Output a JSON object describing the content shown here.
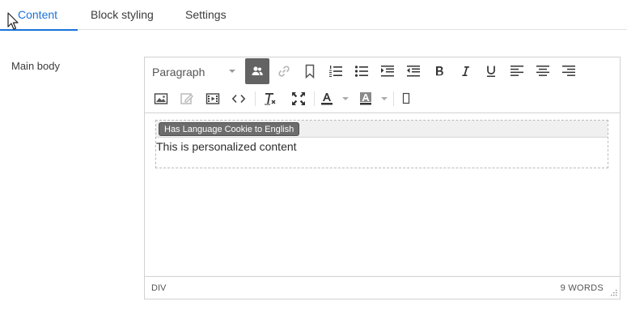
{
  "tabs": [
    {
      "label": "Content",
      "active": true
    },
    {
      "label": "Block styling",
      "active": false
    },
    {
      "label": "Settings",
      "active": false
    }
  ],
  "field": {
    "label": "Main body"
  },
  "editor": {
    "format_select": "Paragraph",
    "toolbar_row1": [
      "personalize-icon",
      "link-icon",
      "bookmark-icon",
      "ordered-list-icon",
      "bullet-list-icon",
      "indent-icon",
      "outdent-icon",
      "bold-icon",
      "italic-icon",
      "underline-icon",
      "align-left-icon",
      "align-center-icon",
      "align-right-icon"
    ],
    "toolbar_row2": [
      "image-icon",
      "edit-image-icon",
      "media-icon",
      "code-icon",
      "clear-format-icon",
      "fullscreen-icon",
      "text-color-icon",
      "background-color-icon",
      "special-char-icon"
    ],
    "personalization": {
      "badge": "Has Language Cookie to English",
      "text": "This is personalized content"
    },
    "status": {
      "path": "DIV",
      "word_count": "9 WORDS"
    }
  },
  "colors": {
    "accent": "#1a73d9",
    "active_button": "#636363"
  }
}
